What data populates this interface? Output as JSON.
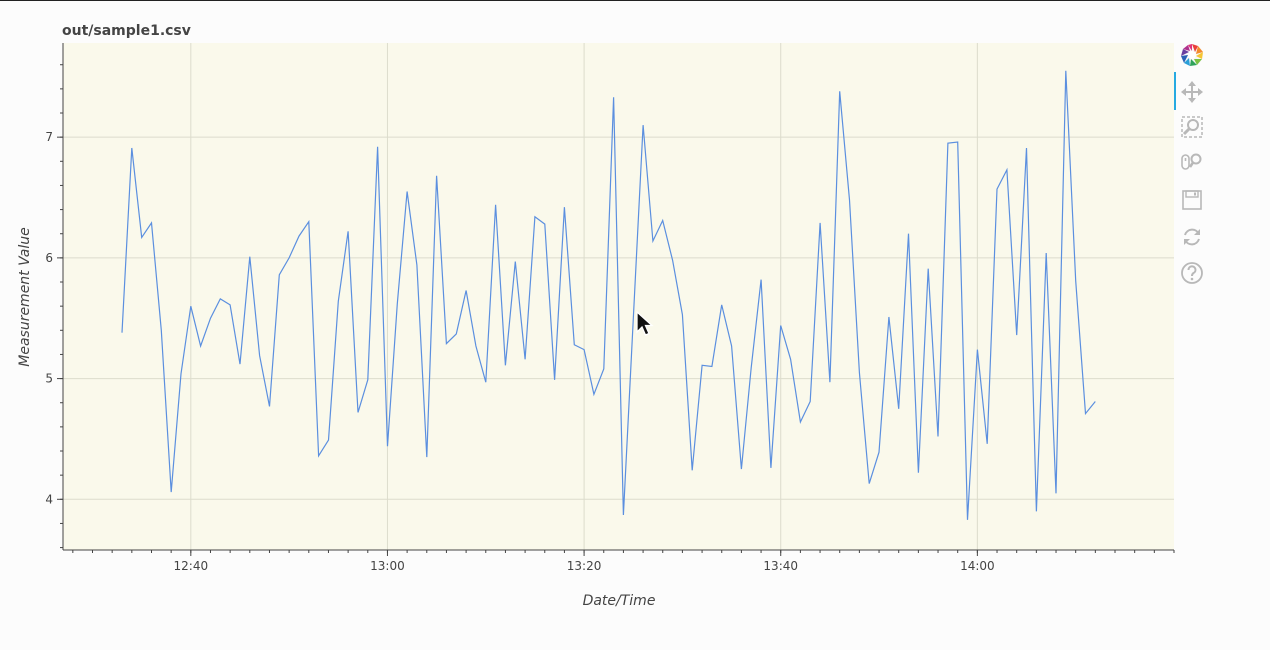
{
  "colors": {
    "line": "#5b8fdf",
    "plot_bg": "#faf9eb",
    "grid": "#dcdccc",
    "axis": "#444444",
    "tool": "#b8b8b8",
    "active_tool": "#26aae1"
  },
  "toolbar": {
    "tools": [
      {
        "icon": "bokeh-logo-icon",
        "active": false
      },
      {
        "icon": "pan-icon",
        "active": true
      },
      {
        "icon": "box-zoom-icon",
        "active": false
      },
      {
        "icon": "wheel-zoom-icon",
        "active": false
      },
      {
        "icon": "save-icon",
        "active": false
      },
      {
        "icon": "reset-icon",
        "active": false
      },
      {
        "icon": "help-icon",
        "active": false
      }
    ]
  },
  "chart_data": {
    "type": "line",
    "title": "out/sample1.csv",
    "xlabel": "Date/Time",
    "ylabel": "Measurement Value",
    "grid": true,
    "xlim": [
      "12:27",
      "14:20"
    ],
    "ylim": [
      3.58,
      7.78
    ],
    "x_ticks": [
      "12:40",
      "13:00",
      "13:20",
      "13:40",
      "14:00"
    ],
    "y_ticks": [
      4,
      5,
      6,
      7
    ],
    "x": [
      "12:33",
      "12:34",
      "12:35",
      "12:36",
      "12:37",
      "12:38",
      "12:39",
      "12:40",
      "12:41",
      "12:42",
      "12:43",
      "12:44",
      "12:45",
      "12:46",
      "12:47",
      "12:48",
      "12:49",
      "12:50",
      "12:51",
      "12:52",
      "12:53",
      "12:54",
      "12:55",
      "12:56",
      "12:57",
      "12:58",
      "12:59",
      "13:00",
      "13:01",
      "13:02",
      "13:03",
      "13:04",
      "13:05",
      "13:06",
      "13:07",
      "13:08",
      "13:09",
      "13:10",
      "13:11",
      "13:12",
      "13:13",
      "13:14",
      "13:15",
      "13:16",
      "13:17",
      "13:18",
      "13:19",
      "13:20",
      "13:21",
      "13:22",
      "13:23",
      "13:24",
      "13:25",
      "13:26",
      "13:27",
      "13:28",
      "13:29",
      "13:30",
      "13:31",
      "13:32",
      "13:33",
      "13:34",
      "13:35",
      "13:36",
      "13:37",
      "13:38",
      "13:39",
      "13:40",
      "13:41",
      "13:42",
      "13:43",
      "13:44",
      "13:45",
      "13:46",
      "13:47",
      "13:48",
      "13:49",
      "13:50",
      "13:51",
      "13:52",
      "13:53",
      "13:54",
      "13:55",
      "13:56",
      "13:57",
      "13:58",
      "13:59",
      "14:00",
      "14:01",
      "14:02",
      "14:03",
      "14:04",
      "14:05",
      "14:06",
      "14:07",
      "14:08",
      "14:09",
      "14:10",
      "14:11",
      "14:12"
    ],
    "values": [
      5.38,
      6.91,
      6.17,
      6.29,
      5.4,
      4.06,
      5.04,
      5.6,
      5.27,
      5.5,
      5.66,
      5.61,
      5.12,
      6.01,
      5.19,
      4.77,
      5.86,
      6.0,
      6.18,
      6.3,
      4.36,
      4.49,
      5.64,
      6.22,
      4.72,
      4.99,
      6.92,
      4.44,
      5.62,
      6.55,
      5.94,
      4.35,
      6.68,
      5.29,
      5.37,
      5.73,
      5.27,
      4.97,
      6.44,
      5.11,
      5.97,
      5.16,
      6.34,
      6.28,
      4.99,
      6.42,
      5.28,
      5.24,
      4.87,
      5.08,
      7.33,
      3.87,
      5.48,
      7.1,
      6.14,
      6.31,
      5.98,
      5.53,
      4.24,
      5.11,
      5.1,
      5.61,
      5.27,
      4.25,
      5.09,
      5.82,
      4.26,
      5.44,
      5.16,
      4.64,
      4.81,
      6.29,
      4.97,
      7.38,
      6.48,
      5.05,
      4.13,
      4.39,
      5.51,
      4.75,
      6.2,
      4.22,
      5.91,
      4.52,
      6.95,
      6.96,
      3.83,
      5.24,
      4.46,
      6.57,
      6.73,
      5.36,
      6.91,
      3.9,
      6.04,
      4.05,
      7.55,
      5.81,
      4.71,
      4.81
    ]
  }
}
